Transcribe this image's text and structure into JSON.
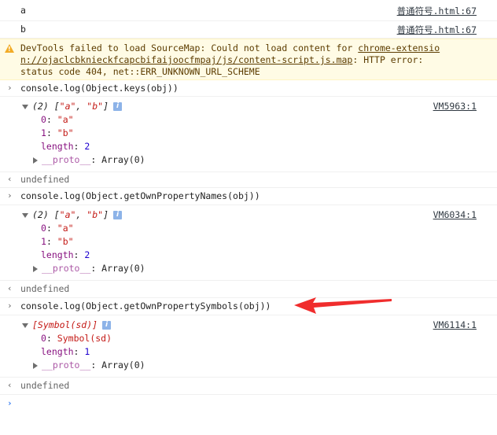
{
  "log_a": {
    "text": "a",
    "source": "普通符号.html:67"
  },
  "log_b": {
    "text": "b",
    "source": "普通符号.html:67"
  },
  "warning": {
    "prefix": "DevTools failed to load SourceMap: Could not load content for ",
    "link_line1": "chrome-extensio",
    "link_line2": "n://ojaclcbknieckfcapcbifaijoocfmpaj/js/content-script.js.map",
    "suffix_line2": ": HTTP error:",
    "line3": "status code 404, net::ERR_UNKNOWN_URL_SCHEME"
  },
  "cmd1": "console.log(Object.keys(obj))",
  "out1": {
    "summary_count": "(2) ",
    "summary_open": "[",
    "summary_a": "\"a\"",
    "summary_sep": ", ",
    "summary_b": "\"b\"",
    "summary_close": "]",
    "source": "VM5963:1",
    "i0_key": "0",
    "i0_val": "\"a\"",
    "i1_key": "1",
    "i1_val": "\"b\"",
    "len_key": "length",
    "len_val": "2",
    "proto_key": "__proto__",
    "proto_val": "Array(0)"
  },
  "undef1": "undefined",
  "cmd2": "console.log(Object.getOwnPropertyNames(obj))",
  "out2": {
    "summary_count": "(2) ",
    "summary_open": "[",
    "summary_a": "\"a\"",
    "summary_sep": ", ",
    "summary_b": "\"b\"",
    "summary_close": "]",
    "source": "VM6034:1",
    "i0_key": "0",
    "i0_val": "\"a\"",
    "i1_key": "1",
    "i1_val": "\"b\"",
    "len_key": "length",
    "len_val": "2",
    "proto_key": "__proto__",
    "proto_val": "Array(0)"
  },
  "undef2": "undefined",
  "cmd3": "console.log(Object.getOwnPropertySymbols(obj))",
  "out3": {
    "summary": "[Symbol(sd)]",
    "source": "VM6114:1",
    "i0_key": "0",
    "i0_val": "Symbol(sd)",
    "len_key": "length",
    "len_val": "1",
    "proto_key": "__proto__",
    "proto_val": "Array(0)"
  },
  "undef3": "undefined",
  "prompt": "",
  "colors": {
    "arrow": "#f02d2d",
    "prompt": "#367cf1",
    "warning_bg": "#fffbe5"
  }
}
